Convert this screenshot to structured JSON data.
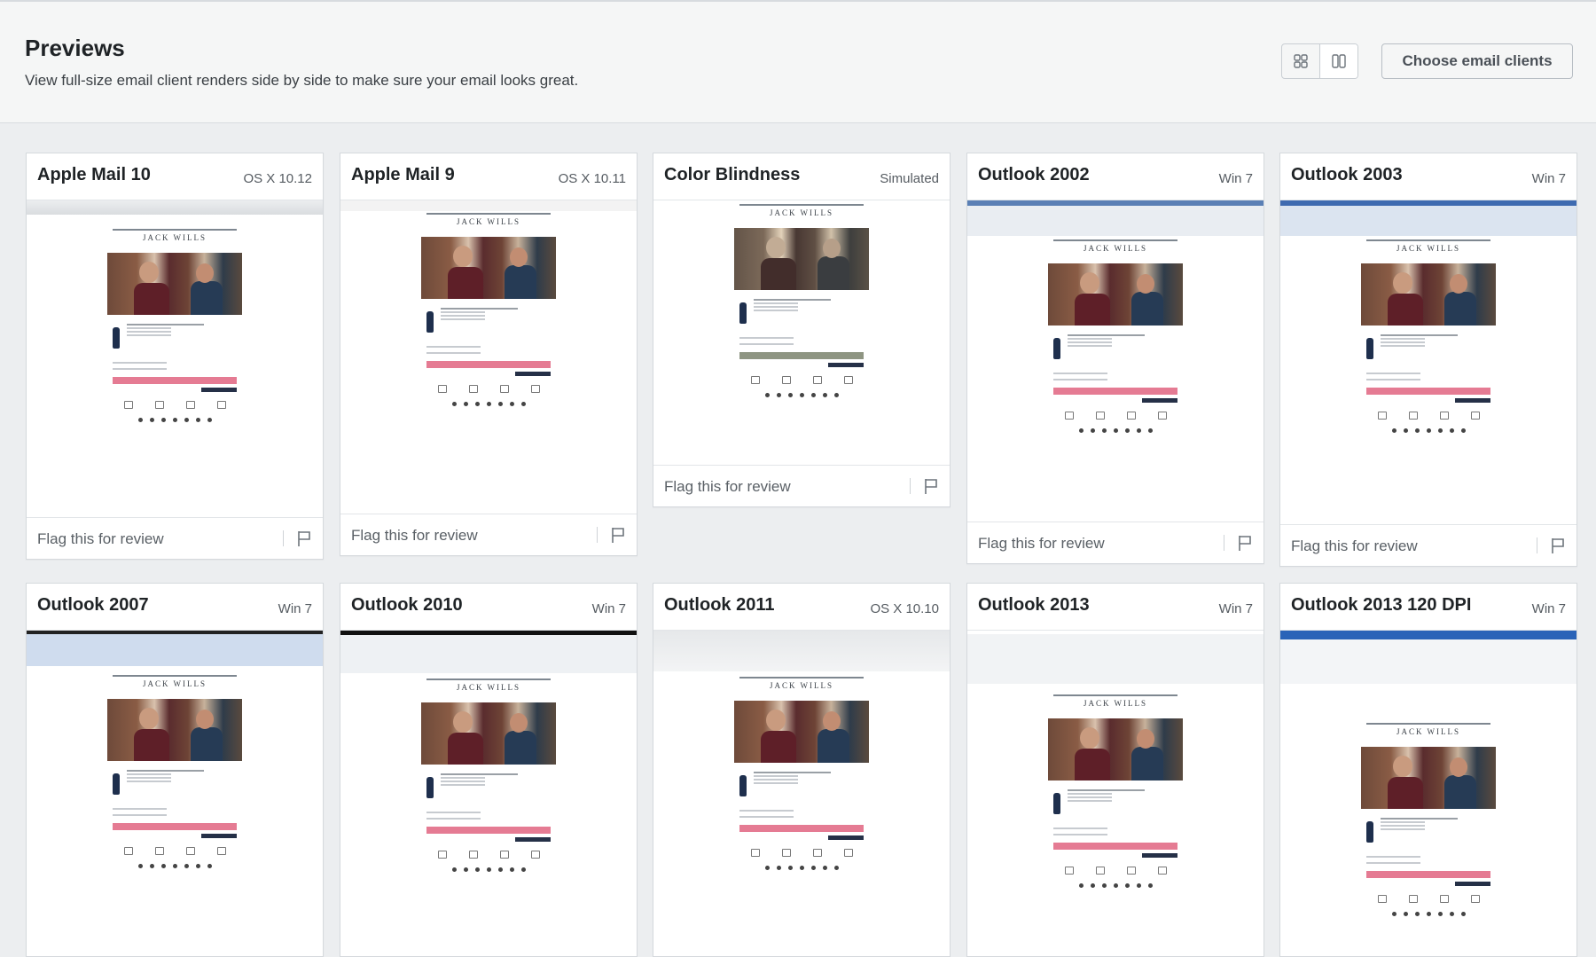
{
  "header": {
    "title": "Previews",
    "subtitle": "View full-size email client renders side by side to make sure your email looks great.",
    "choose_label": "Choose email clients",
    "view_modes": [
      "grid-view-icon",
      "columns-view-icon"
    ],
    "active_view": "columns-view-icon"
  },
  "email_preview": {
    "brand": "JACK WILLS"
  },
  "flag_label": "Flag this for review",
  "cards": [
    {
      "name": "Apple Mail 10",
      "os": "OS X 10.12"
    },
    {
      "name": "Apple Mail 9",
      "os": "OS X 10.11"
    },
    {
      "name": "Color Blindness",
      "os": "Simulated"
    },
    {
      "name": "Outlook 2002",
      "os": "Win 7"
    },
    {
      "name": "Outlook 2003",
      "os": "Win 7"
    },
    {
      "name": "Outlook 2007",
      "os": "Win 7"
    },
    {
      "name": "Outlook 2010",
      "os": "Win 7"
    },
    {
      "name": "Outlook 2011",
      "os": "OS X 10.10"
    },
    {
      "name": "Outlook 2013",
      "os": "Win 7"
    },
    {
      "name": "Outlook 2013 120 DPI",
      "os": "Win 7"
    }
  ],
  "colors": {
    "page_bg": "#eceef0",
    "header_bg": "#f5f6f6",
    "card_border": "#d5d9dd",
    "cta_pink": "#e57b93",
    "brand_navy": "#253047"
  }
}
